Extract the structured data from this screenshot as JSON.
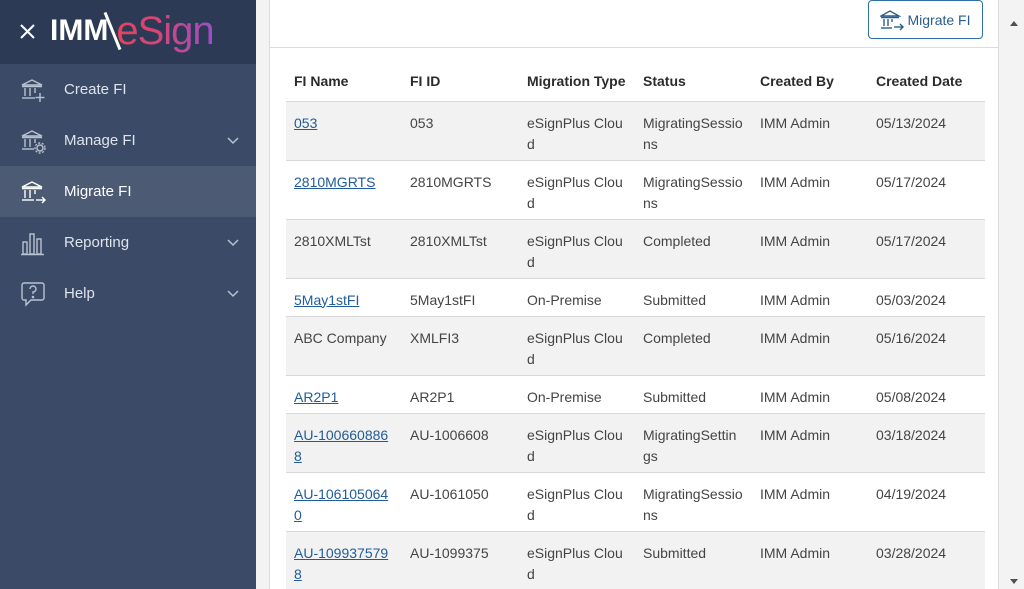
{
  "brand": {
    "prefix": "IMM",
    "suffix": "eSign"
  },
  "sidebar": {
    "items": [
      {
        "label": "Create FI",
        "icon": "bank-plus-icon",
        "active": false,
        "expandable": false
      },
      {
        "label": "Manage FI",
        "icon": "bank-gear-icon",
        "active": false,
        "expandable": true
      },
      {
        "label": "Migrate FI",
        "icon": "bank-arrow-icon",
        "active": true,
        "expandable": false
      },
      {
        "label": "Reporting",
        "icon": "bar-chart-icon",
        "active": false,
        "expandable": true
      },
      {
        "label": "Help",
        "icon": "help-bubble-icon",
        "active": false,
        "expandable": true
      }
    ]
  },
  "toolbar": {
    "migrate_label": "Migrate FI"
  },
  "table": {
    "columns": [
      "FI Name",
      "FI ID",
      "Migration Type",
      "Status",
      "Created By",
      "Created Date"
    ],
    "rows": [
      {
        "name": "053",
        "link": true,
        "id": "053",
        "type": "eSignPlus Cloud",
        "status": "MigratingSessions",
        "by": "IMM Admin",
        "date": "05/13/2024"
      },
      {
        "name": "2810MGRTS",
        "link": true,
        "id": "2810MGRTS",
        "type": "eSignPlus Cloud",
        "status": "MigratingSessions",
        "by": "IMM Admin",
        "date": "05/17/2024"
      },
      {
        "name": "2810XMLTst",
        "link": false,
        "id": "2810XMLTst",
        "type": "eSignPlus Cloud",
        "status": "Completed",
        "by": "IMM Admin",
        "date": "05/17/2024"
      },
      {
        "name": "5May1stFI",
        "link": true,
        "id": "5May1stFI",
        "type": "On-Premise",
        "status": "Submitted",
        "by": "IMM Admin",
        "date": "05/03/2024"
      },
      {
        "name": "ABC Company",
        "link": false,
        "id": "XMLFI3",
        "type": "eSignPlus Cloud",
        "status": "Completed",
        "by": "IMM Admin",
        "date": "05/16/2024"
      },
      {
        "name": "AR2P1",
        "link": true,
        "id": "AR2P1",
        "type": "On-Premise",
        "status": "Submitted",
        "by": "IMM Admin",
        "date": "05/08/2024"
      },
      {
        "name": "AU-1006608868",
        "link": true,
        "id": "AU-1006608",
        "type": "eSignPlus Cloud",
        "status": "MigratingSettings",
        "by": "IMM Admin",
        "date": "03/18/2024"
      },
      {
        "name": "AU-1061050640",
        "link": true,
        "id": "AU-1061050",
        "type": "eSignPlus Cloud",
        "status": "MigratingSessions",
        "by": "IMM Admin",
        "date": "04/19/2024"
      },
      {
        "name": "AU-1099375798",
        "link": true,
        "id": "AU-1099375",
        "type": "eSignPlus Cloud",
        "status": "Submitted",
        "by": "IMM Admin",
        "date": "03/28/2024"
      }
    ]
  }
}
